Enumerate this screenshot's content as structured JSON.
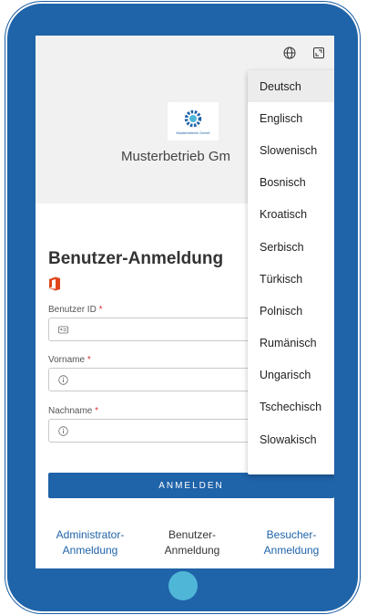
{
  "company": {
    "name": "Musterbetrieb Gm"
  },
  "login": {
    "title": "Benutzer-Anmeldung",
    "fields": [
      {
        "label": "Benutzer ID",
        "required_mark": "*",
        "icon": "id-card-icon"
      },
      {
        "label": "Vorname",
        "required_mark": "*",
        "icon": "info-icon"
      },
      {
        "label": "Nachname",
        "required_mark": "*",
        "icon": "info-icon"
      }
    ],
    "submit_label": "ANMELDEN"
  },
  "links": {
    "admin": {
      "line1": "Administrator-",
      "line2": "Anmeldung"
    },
    "user": {
      "line1": "Benutzer-",
      "line2": "Anmeldung"
    },
    "visitor": {
      "line1": "Besucher-",
      "line2": "Anmeldung"
    }
  },
  "language_menu": {
    "selected": "Deutsch",
    "options": [
      "Deutsch",
      "Englisch",
      "Slowenisch",
      "Bosnisch",
      "Kroatisch",
      "Serbisch",
      "Türkisch",
      "Polnisch",
      "Rumänisch",
      "Ungarisch",
      "Tschechisch",
      "Slowakisch"
    ]
  },
  "colors": {
    "accent": "#1f63a8",
    "home_button": "#4fb6d8",
    "required": "#dd3333",
    "office": "#e0461c"
  }
}
